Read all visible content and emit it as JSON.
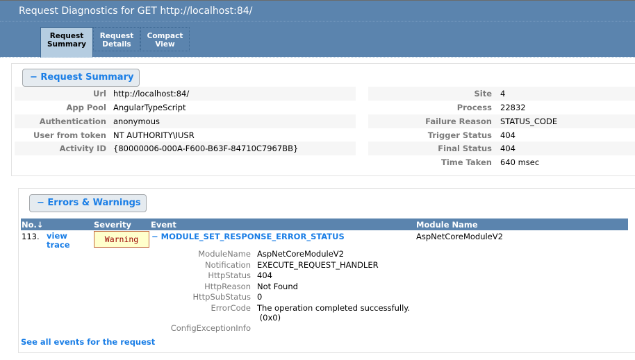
{
  "window": {
    "title": "Request Diagnostics for GET http://localhost:84/"
  },
  "tabs": [
    {
      "label_line1": "Request",
      "label_line2": "Summary",
      "active": true
    },
    {
      "label_line1": "Request",
      "label_line2": "Details",
      "active": false
    },
    {
      "label_line1": "Compact",
      "label_line2": "View",
      "active": false
    }
  ],
  "request_summary": {
    "toggle_label": "− Request Summary",
    "left": [
      {
        "label": "Url",
        "value": "http://localhost:84/"
      },
      {
        "label": "App Pool",
        "value": "AngularTypeScript"
      },
      {
        "label": "Authentication",
        "value": "anonymous"
      },
      {
        "label": "User from token",
        "value": "NT AUTHORITY\\IUSR"
      },
      {
        "label": "Activity ID",
        "value": "{80000006-000A-F600-B63F-84710C7967BB}"
      }
    ],
    "right": [
      {
        "label": "Site",
        "value": "4"
      },
      {
        "label": "Process",
        "value": "22832"
      },
      {
        "label": "Failure Reason",
        "value": "STATUS_CODE"
      },
      {
        "label": "Trigger Status",
        "value": "404"
      },
      {
        "label": "Final Status",
        "value": "404"
      },
      {
        "label": "Time Taken",
        "value": "640 msec"
      }
    ]
  },
  "errors": {
    "toggle_label": "− Errors & Warnings",
    "columns": {
      "no": "No.↓",
      "severity": "Severity",
      "event": "Event",
      "module": "Module Name"
    },
    "rows": [
      {
        "no": "113.",
        "trace_link_line1": "view",
        "trace_link_line2": "trace",
        "severity": "Warning",
        "event": "− MODULE_SET_RESPONSE_ERROR_STATUS",
        "module": "AspNetCoreModuleV2",
        "details": [
          {
            "label": "ModuleName",
            "value": "AspNetCoreModuleV2"
          },
          {
            "label": "Notification",
            "value": "EXECUTE_REQUEST_HANDLER"
          },
          {
            "label": "HttpStatus",
            "value": "404"
          },
          {
            "label": "HttpReason",
            "value": "Not Found"
          },
          {
            "label": "HttpSubStatus",
            "value": "0"
          },
          {
            "label": "ErrorCode",
            "value": "The operation completed successfully.",
            "value_line2": " (0x0)"
          },
          {
            "label": "ConfigExceptionInfo",
            "value": ""
          }
        ]
      }
    ],
    "see_all_link": "See all events for the request"
  },
  "colors": {
    "header_bg": "#5b84ae",
    "link": "#1a7ee6",
    "warning_bg": "#ffffcc",
    "warning_text": "#990000"
  }
}
